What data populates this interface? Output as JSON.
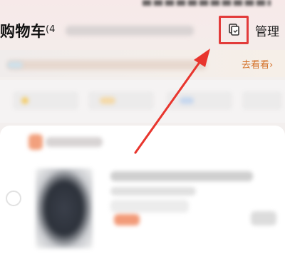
{
  "header": {
    "title": "购物车",
    "count": "(4",
    "manage_label": "管理",
    "icon": "cart-share-icon"
  },
  "notice": {
    "link_label": "去看看›"
  },
  "colors": {
    "highlight_box": "#e23b3b",
    "arrow": "#e8352d",
    "link": "#d4722a"
  }
}
